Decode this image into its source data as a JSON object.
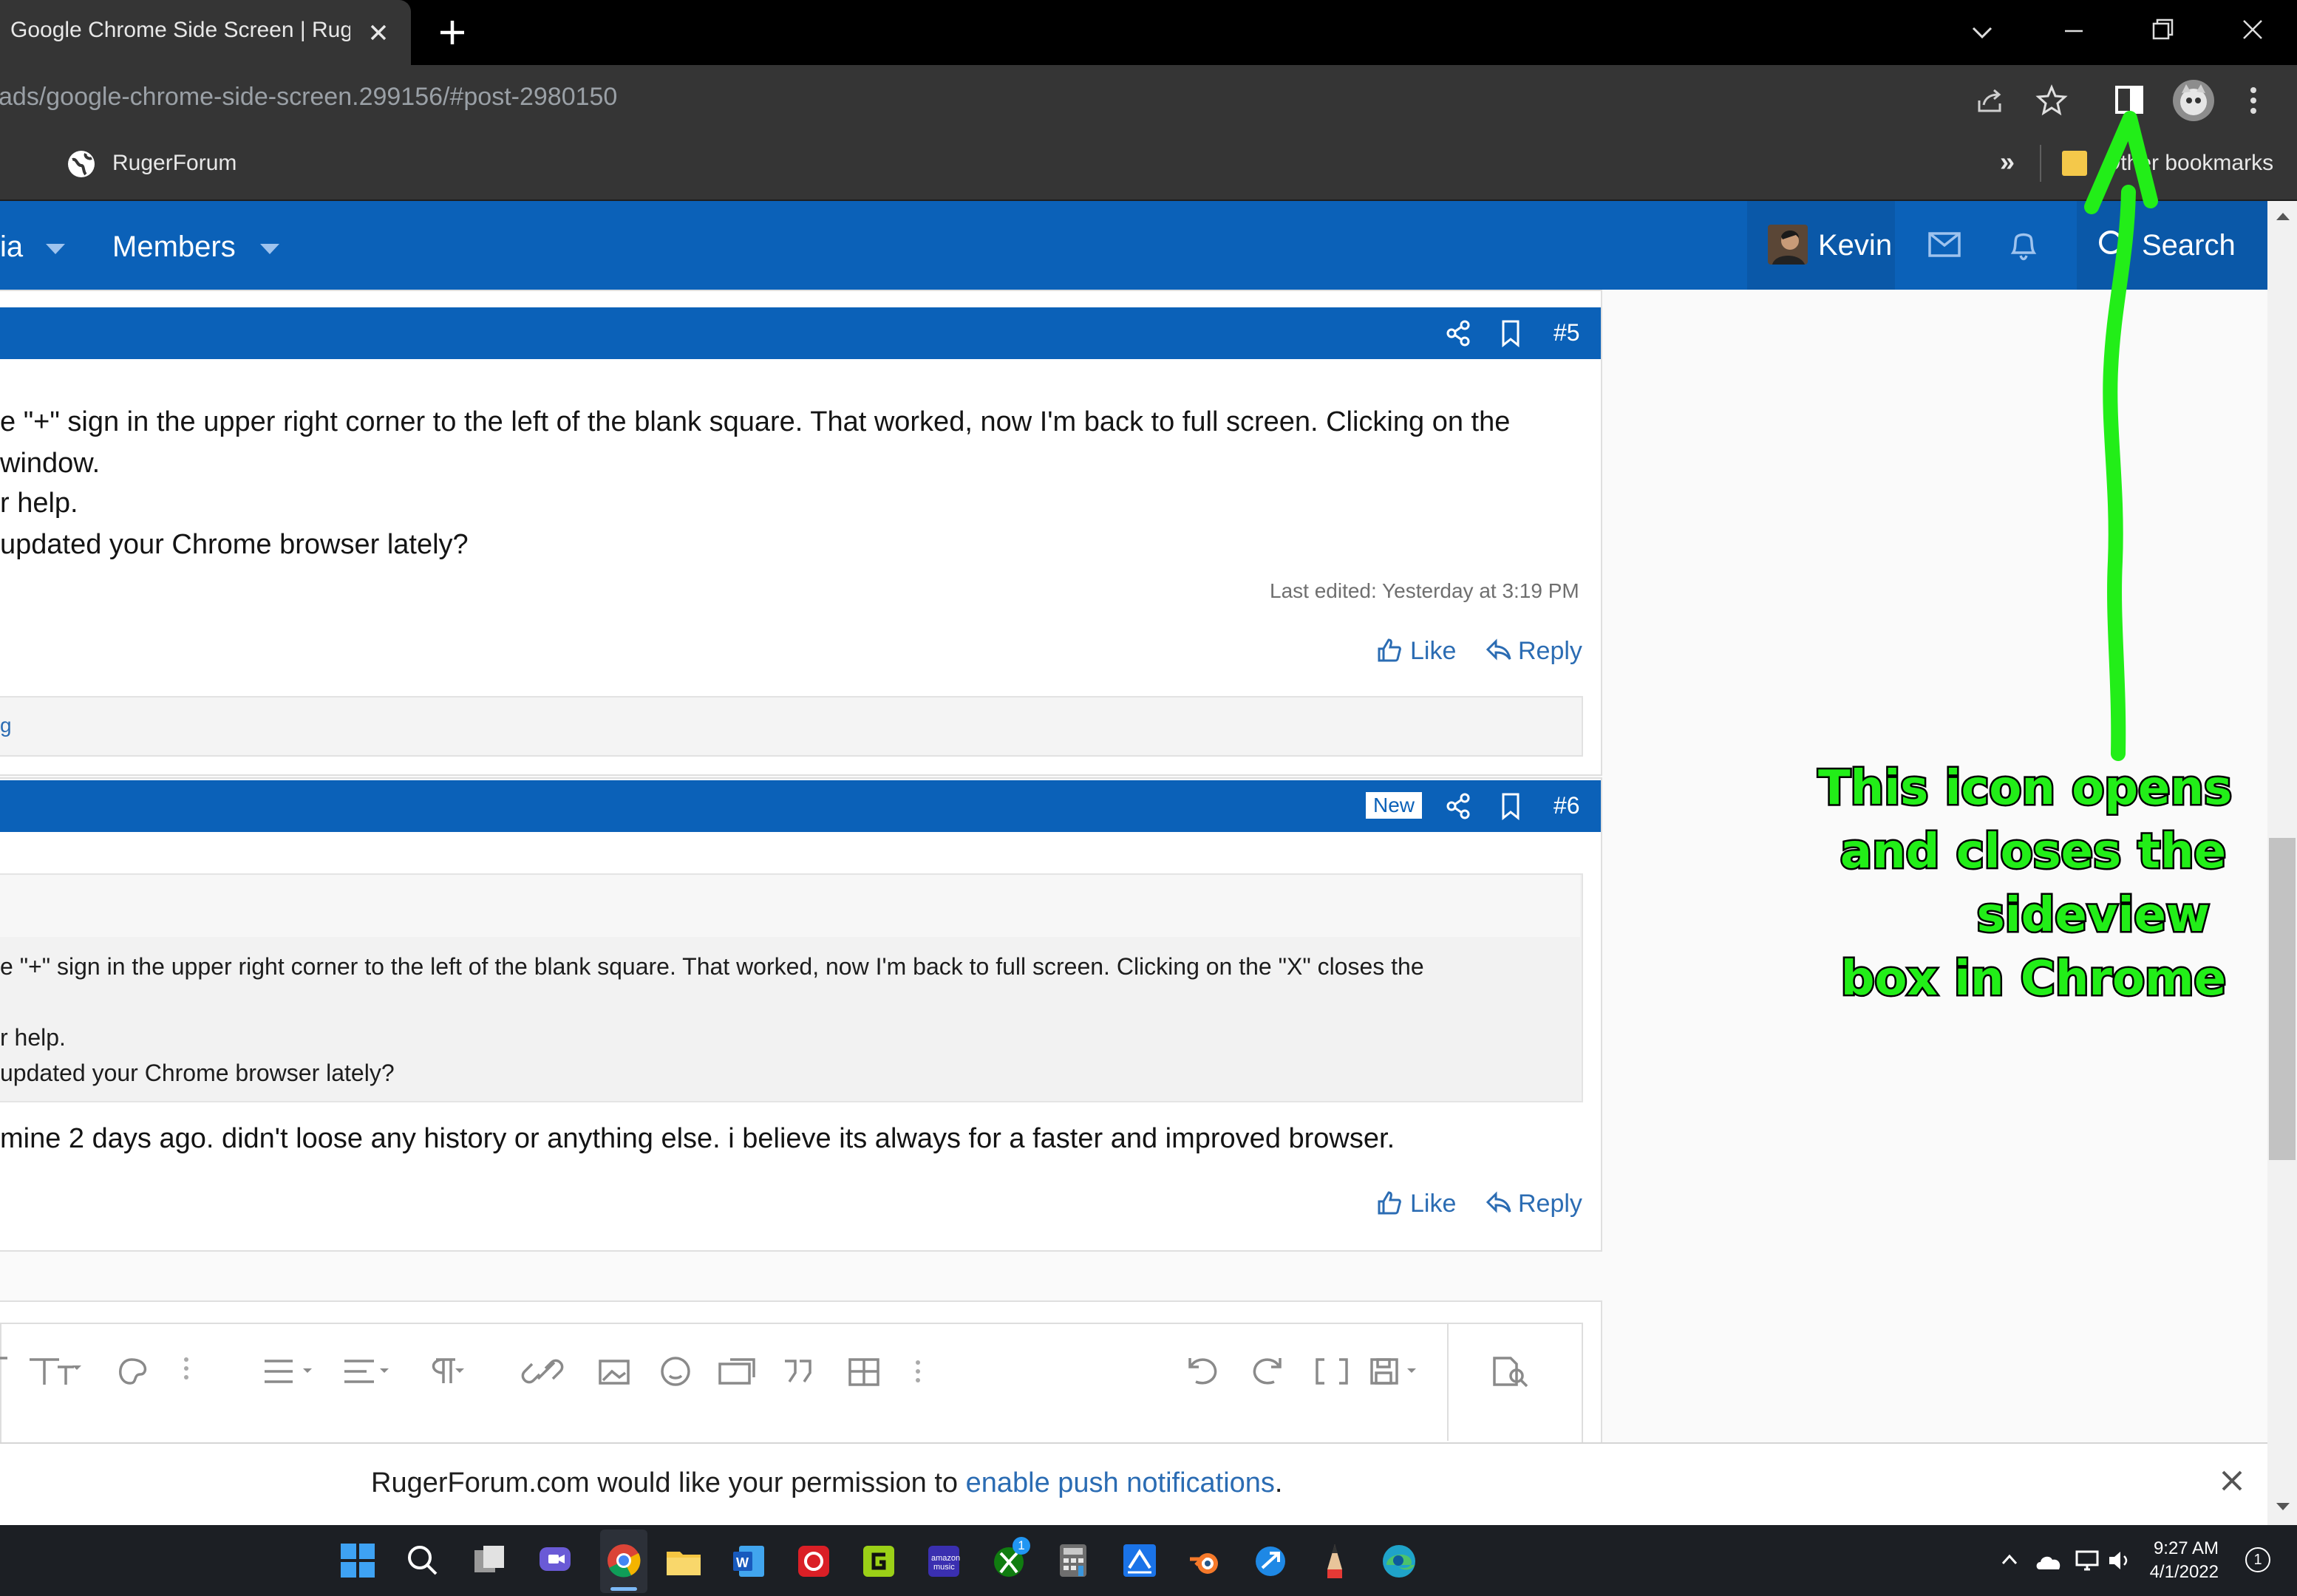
{
  "browser": {
    "tab_title": "Google Chrome Side Screen | RugerF",
    "url": "ads/google-chrome-side-screen.299156/#post-2980150",
    "bookmark_item": "RugerForum",
    "other_bookmarks": "Other bookmarks"
  },
  "nav": {
    "partial_item": "ia",
    "members": "Members",
    "user": "Kevin",
    "search": "Search"
  },
  "post5": {
    "number": "#5",
    "lines": [
      "e \"+\" sign in the upper right corner to the left of the blank square. That worked, now I'm back to full screen. Clicking on the",
      "window.",
      "r help.",
      " updated your Chrome browser lately?"
    ],
    "last_edited": "Last edited: Yesterday at 3:19 PM",
    "like": "Like",
    "reply": "Reply",
    "reactions_partial": "g"
  },
  "post6": {
    "badge": "New",
    "number": "#6",
    "quote_lines": [
      "e \"+\" sign in the upper right corner to the left of the blank square. That worked, now I'm back to full screen. Clicking on the \"X\" closes the",
      "r help.",
      " updated your Chrome browser lately?"
    ],
    "body": "mine 2 days ago. didn't loose any history or anything else. i believe its always for a faster and improved browser.",
    "like": "Like",
    "reply": "Reply"
  },
  "notification": {
    "prefix": "RugerForum.com would like your permission to ",
    "link": "enable push notifications",
    "suffix": "."
  },
  "annotation": {
    "lines": [
      "This icon opens",
      "and closes the",
      "sideview",
      "box in Chrome"
    ],
    "color": "#22ee18"
  },
  "taskbar": {
    "time": "9:27 AM",
    "date": "4/1/2022",
    "notif_count": "1",
    "xbox_badge": "1"
  }
}
